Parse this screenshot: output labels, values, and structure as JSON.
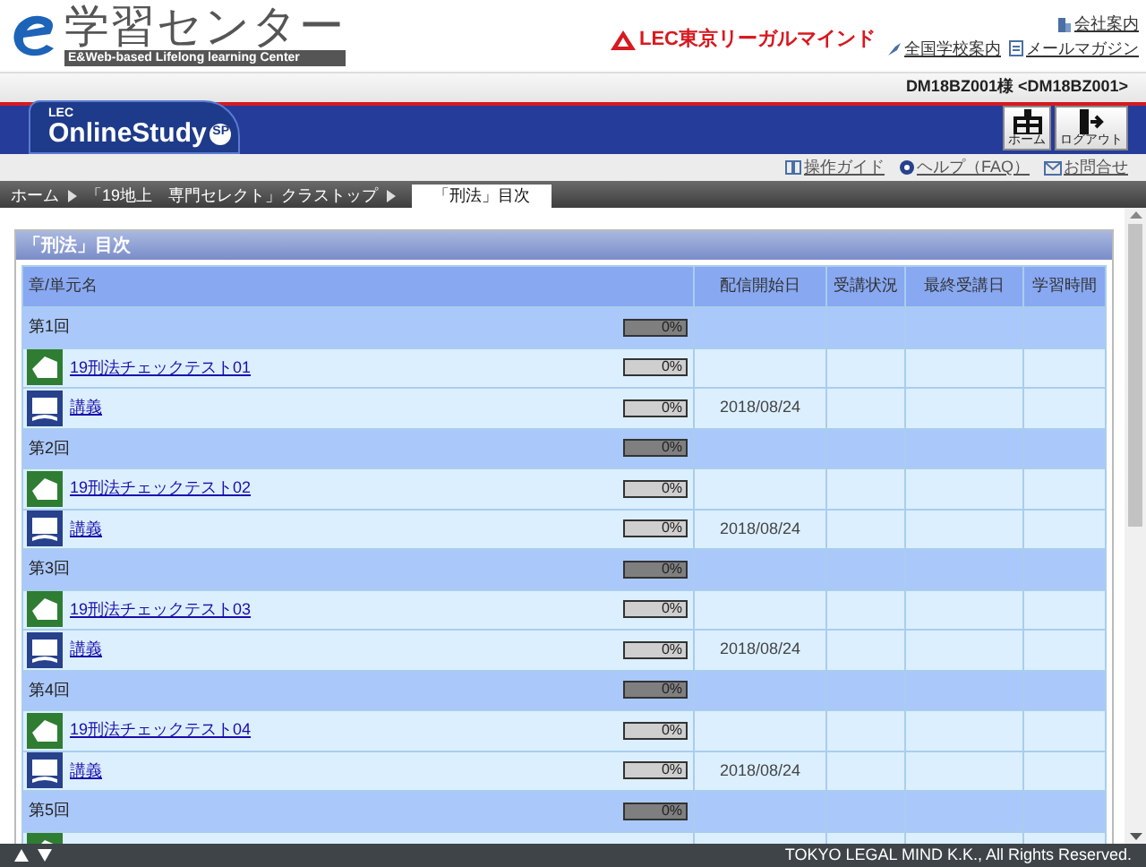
{
  "header": {
    "logo_title": "学習センター",
    "logo_subtitle": "E&Web-based Lifelong learning Center",
    "brand": "LEC東京リーガルマインド",
    "links": [
      {
        "label": "会社案内",
        "kind": "company"
      },
      {
        "label": "全国学校案内",
        "kind": "school"
      },
      {
        "label": "メールマガジン",
        "kind": "mail"
      }
    ],
    "user": "DM18BZ001様 <DM18BZ001>"
  },
  "nav": {
    "tab_small": "LEC",
    "tab_label": "OnlineStudy",
    "tab_badge": "SP",
    "buttons": [
      {
        "label": "ホーム",
        "kind": "home"
      },
      {
        "label": "ログアウト",
        "kind": "logout"
      }
    ]
  },
  "help_links": [
    {
      "label": "操作ガイド",
      "kind": "guide"
    },
    {
      "label": "ヘルプ（FAQ）",
      "kind": "help"
    },
    {
      "label": "お問合せ",
      "kind": "contact"
    }
  ],
  "breadcrumb": [
    {
      "label": "ホーム",
      "selected": false
    },
    {
      "label": "「19地上　専門セレクト」クラストップ",
      "selected": false
    },
    {
      "label": "「刑法」目次",
      "selected": true
    }
  ],
  "panel": {
    "title": "「刑法」目次",
    "columns": [
      "章/単元名",
      "配信開始日",
      "受講状況",
      "最終受講日",
      "学習時間"
    ],
    "rows": [
      {
        "kind": "section",
        "name": "第1回",
        "progress": "0%",
        "level": 0
      },
      {
        "kind": "test",
        "name": "19刑法チェックテスト01",
        "progress": "0%",
        "level": 0
      },
      {
        "kind": "lecture",
        "name": "講義",
        "progress": "0%",
        "level": 0,
        "date": "2018/08/24"
      },
      {
        "kind": "section",
        "name": "第2回",
        "progress": "0%",
        "level": 0
      },
      {
        "kind": "test",
        "name": "19刑法チェックテスト02",
        "progress": "0%",
        "level": 0
      },
      {
        "kind": "lecture",
        "name": "講義",
        "progress": "0%",
        "level": 0,
        "date": "2018/08/24"
      },
      {
        "kind": "section",
        "name": "第3回",
        "progress": "0%",
        "level": 0
      },
      {
        "kind": "test",
        "name": "19刑法チェックテスト03",
        "progress": "0%",
        "level": 0
      },
      {
        "kind": "lecture",
        "name": "講義",
        "progress": "0%",
        "level": 0,
        "date": "2018/08/24"
      },
      {
        "kind": "section",
        "name": "第4回",
        "progress": "0%",
        "level": 0
      },
      {
        "kind": "test",
        "name": "19刑法チェックテスト04",
        "progress": "0%",
        "level": 0
      },
      {
        "kind": "lecture",
        "name": "講義",
        "progress": "0%",
        "level": 0,
        "date": "2018/08/24"
      },
      {
        "kind": "section",
        "name": "第5回",
        "progress": "0%",
        "level": 0
      },
      {
        "kind": "test"
      }
    ]
  },
  "footer": {
    "copyright": "TOKYO LEGAL MIND K.K., All Rights Reserved."
  }
}
